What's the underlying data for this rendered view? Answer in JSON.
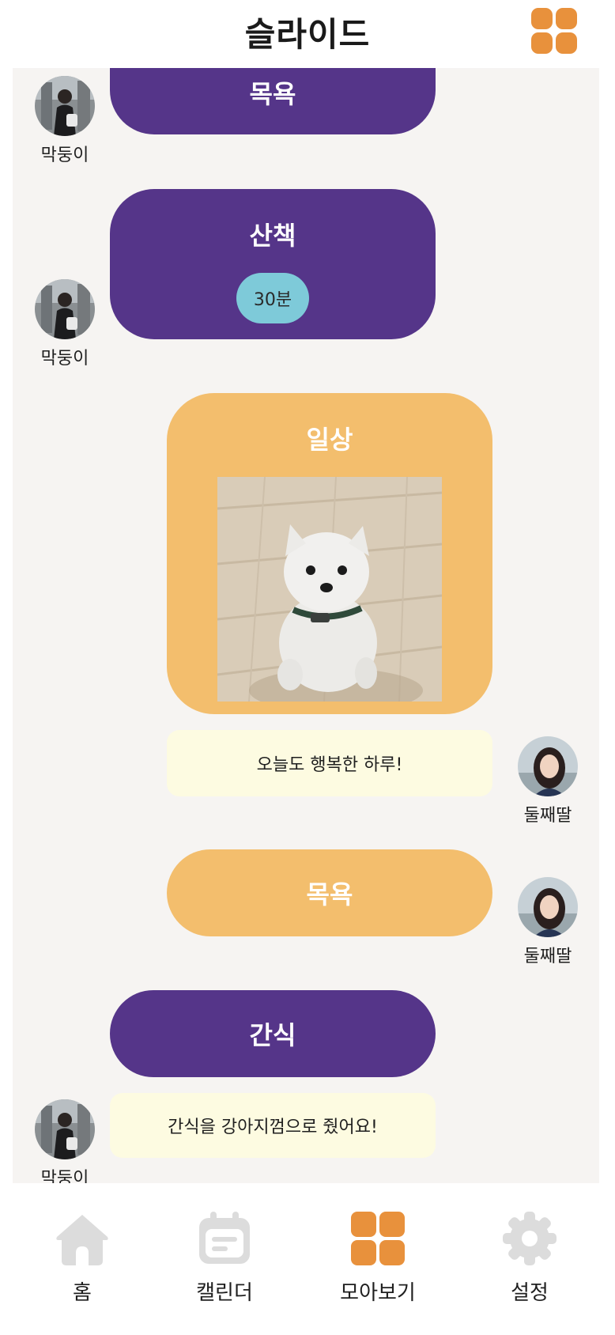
{
  "header": {
    "title": "슬라이드"
  },
  "feed": {
    "posts": [
      {
        "title": "목욕",
        "author": "막둥이"
      },
      {
        "title": "산책",
        "tag": "30분",
        "author": "막둥이"
      },
      {
        "title": "일상",
        "note": "오늘도 행복한 하루!",
        "author": "둘째딸"
      },
      {
        "title": "목욕",
        "author": "둘째딸"
      },
      {
        "title": "간식",
        "note": "간식을 강아지껌으로 줬어요!",
        "author": "막둥이"
      }
    ]
  },
  "nav": {
    "items": [
      {
        "label": "홈",
        "icon": "home-icon"
      },
      {
        "label": "캘린더",
        "icon": "calendar-icon"
      },
      {
        "label": "모아보기",
        "icon": "grid-icon"
      },
      {
        "label": "설정",
        "icon": "gear-icon"
      }
    ]
  },
  "colors": {
    "accent": "#e8913c",
    "purple": "#553589",
    "orange": "#f3be6d",
    "note_bg": "#fdfbe1",
    "tag": "#7ecad9",
    "inactive": "#dcdcdc"
  }
}
